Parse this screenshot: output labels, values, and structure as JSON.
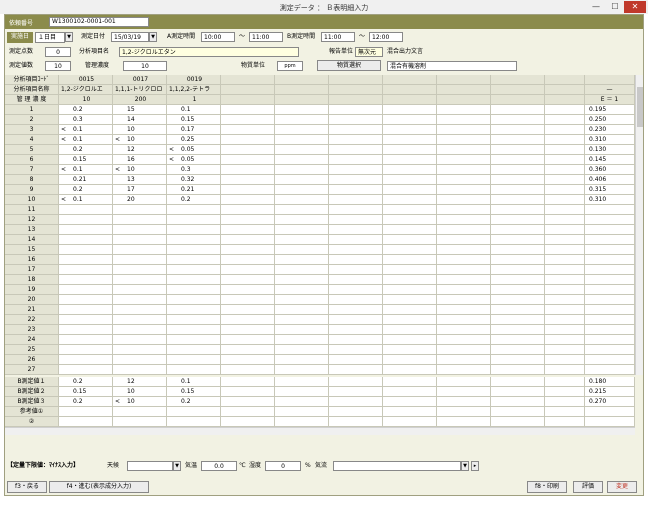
{
  "window": {
    "title": "測定データ ： Ｂ表明細入力",
    "min": "—",
    "max": "☐",
    "close": "✕"
  },
  "header": {
    "request_label": "依頼番号",
    "request_value": "W1300102-0001-001",
    "day_label": "実施日",
    "day_value": "１日目",
    "date_label": "測定日付",
    "date_value": "15/03/19",
    "a_time_label": "A測定時間",
    "a_time_from": "10:00",
    "a_time_tilde": "～",
    "a_time_to": "11:00",
    "b_time_label": "B測定時間",
    "b_time_from": "11:00",
    "b_time_tilde": "～",
    "b_time_to": "12:00",
    "points_label": "測定点数",
    "points_value": "0",
    "item_name_label": "分析項目名",
    "item_name_value": "1,2-ジクロルエタン",
    "report_unit_label": "報告単位",
    "report_unit_value": "無次元",
    "mixed_output_label": "混合出力文言",
    "count_label": "測定値数",
    "count_value": "10",
    "mgmt_label": "管理濃度",
    "mgmt_value": "10",
    "substance_unit_label": "物質単位",
    "substance_unit_value": "ppm",
    "select_button": "物質選択",
    "mixed_text": "混合有機溶剤"
  },
  "grid": {
    "row_labels": [
      "分析項目ｺｰﾄﾞ",
      "分析項目名称",
      "管 理 濃 度"
    ],
    "columns": [
      {
        "code": "0015",
        "name": "1,2-ジクロルエ",
        "mgmt": "10"
      },
      {
        "code": "0017",
        "name": "1,1,1-トリクロロ",
        "mgmt": "200"
      },
      {
        "code": "0019",
        "name": "1,1,2,2-テトラ",
        "mgmt": "1"
      }
    ],
    "right_header": {
      "dash": "—",
      "e": "E ＝ 1"
    },
    "rows": [
      {
        "n": "1",
        "c": [
          [
            "",
            "0.2"
          ],
          [
            "",
            "15"
          ],
          [
            "",
            "0.1"
          ]
        ],
        "e": "0.195"
      },
      {
        "n": "2",
        "c": [
          [
            "",
            "0.3"
          ],
          [
            "",
            "14"
          ],
          [
            "",
            "0.15"
          ]
        ],
        "e": "0.250"
      },
      {
        "n": "3",
        "c": [
          [
            "<",
            "0.1"
          ],
          [
            "",
            "10"
          ],
          [
            "",
            "0.17"
          ]
        ],
        "e": "0.230"
      },
      {
        "n": "4",
        "c": [
          [
            "<",
            "0.1"
          ],
          [
            "<",
            "10"
          ],
          [
            "",
            "0.25"
          ]
        ],
        "e": "0.310"
      },
      {
        "n": "5",
        "c": [
          [
            "",
            "0.2"
          ],
          [
            "",
            "12"
          ],
          [
            "<",
            "0.05"
          ]
        ],
        "e": "0.130"
      },
      {
        "n": "6",
        "c": [
          [
            "",
            "0.15"
          ],
          [
            "",
            "16"
          ],
          [
            "<",
            "0.05"
          ]
        ],
        "e": "0.145"
      },
      {
        "n": "7",
        "c": [
          [
            "<",
            "0.1"
          ],
          [
            "<",
            "10"
          ],
          [
            "",
            "0.3"
          ]
        ],
        "e": "0.360"
      },
      {
        "n": "8",
        "c": [
          [
            "",
            "0.21"
          ],
          [
            "",
            "13"
          ],
          [
            "",
            "0.32"
          ]
        ],
        "e": "0.406"
      },
      {
        "n": "9",
        "c": [
          [
            "",
            "0.2"
          ],
          [
            "",
            "17"
          ],
          [
            "",
            "0.21"
          ]
        ],
        "e": "0.315"
      },
      {
        "n": "10",
        "c": [
          [
            "<",
            "0.1"
          ],
          [
            "",
            "20"
          ],
          [
            "",
            "0.2"
          ]
        ],
        "e": "0.310"
      },
      {
        "n": "11",
        "c": [
          [
            "",
            ""
          ],
          [
            "",
            ""
          ],
          [
            "",
            ""
          ]
        ],
        "e": ""
      },
      {
        "n": "12",
        "c": [
          [
            "",
            ""
          ],
          [
            "",
            ""
          ],
          [
            "",
            ""
          ]
        ],
        "e": ""
      },
      {
        "n": "13",
        "c": [
          [
            "",
            ""
          ],
          [
            "",
            ""
          ],
          [
            "",
            ""
          ]
        ],
        "e": ""
      },
      {
        "n": "14",
        "c": [
          [
            "",
            ""
          ],
          [
            "",
            ""
          ],
          [
            "",
            ""
          ]
        ],
        "e": ""
      },
      {
        "n": "15",
        "c": [
          [
            "",
            ""
          ],
          [
            "",
            ""
          ],
          [
            "",
            ""
          ]
        ],
        "e": ""
      },
      {
        "n": "16",
        "c": [
          [
            "",
            ""
          ],
          [
            "",
            ""
          ],
          [
            "",
            ""
          ]
        ],
        "e": ""
      },
      {
        "n": "17",
        "c": [
          [
            "",
            ""
          ],
          [
            "",
            ""
          ],
          [
            "",
            ""
          ]
        ],
        "e": ""
      },
      {
        "n": "18",
        "c": [
          [
            "",
            ""
          ],
          [
            "",
            ""
          ],
          [
            "",
            ""
          ]
        ],
        "e": ""
      },
      {
        "n": "19",
        "c": [
          [
            "",
            ""
          ],
          [
            "",
            ""
          ],
          [
            "",
            ""
          ]
        ],
        "e": ""
      },
      {
        "n": "20",
        "c": [
          [
            "",
            ""
          ],
          [
            "",
            ""
          ],
          [
            "",
            ""
          ]
        ],
        "e": ""
      },
      {
        "n": "21",
        "c": [
          [
            "",
            ""
          ],
          [
            "",
            ""
          ],
          [
            "",
            ""
          ]
        ],
        "e": ""
      },
      {
        "n": "22",
        "c": [
          [
            "",
            ""
          ],
          [
            "",
            ""
          ],
          [
            "",
            ""
          ]
        ],
        "e": ""
      },
      {
        "n": "23",
        "c": [
          [
            "",
            ""
          ],
          [
            "",
            ""
          ],
          [
            "",
            ""
          ]
        ],
        "e": ""
      },
      {
        "n": "24",
        "c": [
          [
            "",
            ""
          ],
          [
            "",
            ""
          ],
          [
            "",
            ""
          ]
        ],
        "e": ""
      },
      {
        "n": "25",
        "c": [
          [
            "",
            ""
          ],
          [
            "",
            ""
          ],
          [
            "",
            ""
          ]
        ],
        "e": ""
      },
      {
        "n": "26",
        "c": [
          [
            "",
            ""
          ],
          [
            "",
            ""
          ],
          [
            "",
            ""
          ]
        ],
        "e": ""
      },
      {
        "n": "27",
        "c": [
          [
            "",
            ""
          ],
          [
            "",
            ""
          ],
          [
            "",
            ""
          ]
        ],
        "e": ""
      }
    ],
    "summary_rows": [
      {
        "n": "B測定値１",
        "c": [
          [
            "",
            "0.2"
          ],
          [
            "",
            "12"
          ],
          [
            "",
            "0.1"
          ]
        ],
        "e": "0.180"
      },
      {
        "n": "B測定値２",
        "c": [
          [
            "",
            "0.15"
          ],
          [
            "",
            "10"
          ],
          [
            "",
            "0.15"
          ]
        ],
        "e": "0.215"
      },
      {
        "n": "B測定値３",
        "c": [
          [
            "",
            "0.2"
          ],
          [
            "<",
            "10"
          ],
          [
            "",
            "0.2"
          ]
        ],
        "e": "0.270"
      },
      {
        "n": "参考値①",
        "c": [
          [
            "",
            ""
          ],
          [
            "",
            ""
          ],
          [
            "",
            ""
          ]
        ],
        "e": ""
      },
      {
        "n": "②",
        "c": [
          [
            "",
            ""
          ],
          [
            "",
            ""
          ],
          [
            "",
            ""
          ]
        ],
        "e": ""
      }
    ]
  },
  "bottom": {
    "limit_label": "【定量下限値：ﾏｲﾅｽ入力】",
    "weather_label": "天候",
    "temp_label": "気温",
    "temp_value": "0.0",
    "temp_unit": "℃",
    "humidity_label": "湿度",
    "humidity_value": "0",
    "humidity_unit": "%",
    "airflow_label": "気流"
  },
  "footer": {
    "f3": "f3・戻る",
    "f4": "f4・進む(表示成分入力)",
    "f8": "f8・印刷",
    "eval": "評価",
    "change": "変更"
  },
  "colors": {
    "olive": "#8b8b4b",
    "panel": "#f2f2e3",
    "accent_red": "#c0392b"
  }
}
